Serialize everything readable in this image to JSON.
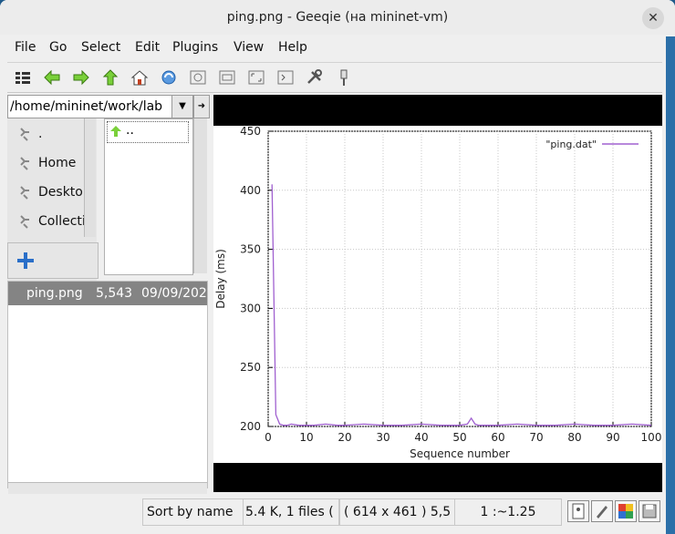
{
  "window": {
    "title": "ping.png - Geeqie (на mininet-vm)"
  },
  "menubar": {
    "items": [
      "File",
      "Go",
      "Select",
      "Edit",
      "Plugins",
      "View",
      "Help"
    ]
  },
  "toolbar": {
    "icons": [
      "thumbnails-icon",
      "back-icon",
      "forward-icon",
      "up-icon",
      "home-icon",
      "refresh-icon",
      "zoom-in-icon",
      "zoom-out-icon",
      "zoom-fit-icon",
      "zoom-1to1-icon",
      "settings-icon",
      "pin-icon"
    ]
  },
  "path": {
    "value": "/home/mininet/work/lab"
  },
  "bookmarks": {
    "items": [
      ".",
      "Home",
      "Desktop",
      "Collections"
    ]
  },
  "dirlist": {
    "items": [
      ".."
    ]
  },
  "filelist": {
    "row": {
      "name": "ping.png",
      "size": "5,543",
      "date": "09/09/202"
    }
  },
  "statusbar": {
    "sort": "Sort by name",
    "files": "5.4 K, 1 files (",
    "dims": "( 614 x 461 ) 5,5",
    "zoom": "1 :~1.25"
  },
  "chart_data": {
    "type": "line",
    "xlabel": "Sequence number",
    "ylabel": "Delay (ms)",
    "xlim": [
      0,
      100
    ],
    "ylim": [
      200,
      450
    ],
    "xticks": [
      0,
      10,
      20,
      30,
      40,
      50,
      60,
      70,
      80,
      90,
      100
    ],
    "yticks": [
      200,
      250,
      300,
      350,
      400,
      450
    ],
    "grid": true,
    "legend": "top-right",
    "series": [
      {
        "name": "\"ping.dat\"",
        "color": "#a060d0",
        "x": [
          1,
          2,
          3,
          4,
          5,
          6,
          8,
          10,
          12,
          15,
          18,
          20,
          25,
          30,
          35,
          40,
          45,
          50,
          52,
          53,
          54,
          55,
          60,
          65,
          70,
          75,
          80,
          85,
          90,
          95,
          100
        ],
        "y": [
          405,
          210,
          202,
          201,
          201,
          202,
          201,
          201,
          201,
          202,
          201,
          201,
          202,
          201,
          201,
          202,
          201,
          201,
          202,
          207,
          202,
          201,
          201,
          202,
          201,
          201,
          202,
          201,
          201,
          202,
          201
        ]
      }
    ]
  }
}
